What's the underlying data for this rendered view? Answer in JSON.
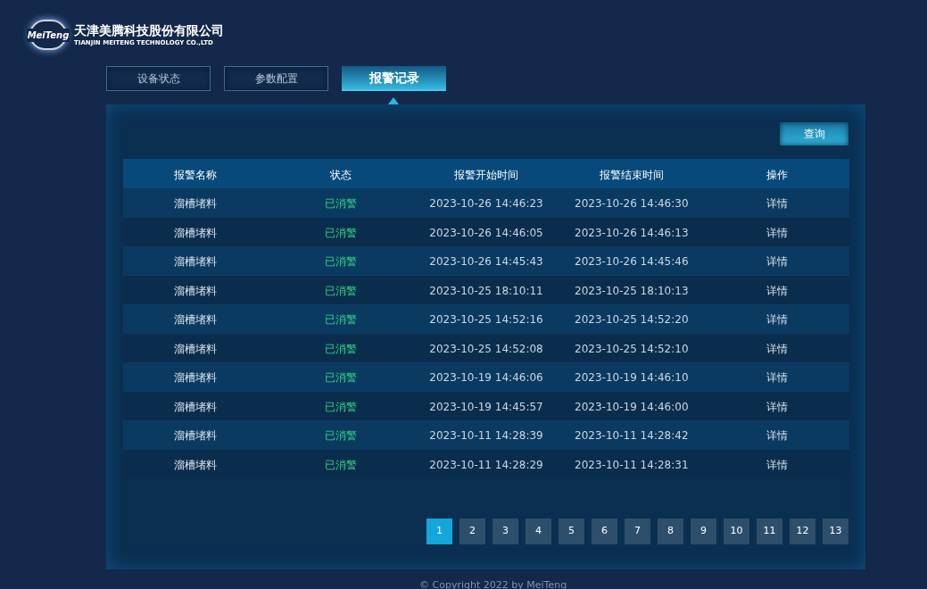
{
  "header": {
    "logo_text": "MeiTeng",
    "company_name": "天津美腾科技股份有限公司",
    "company_name_en": "TIANJIN MEITENG TECHNOLOGY CO.,LTD"
  },
  "tabs": [
    {
      "label": "设备状态",
      "selected": false
    },
    {
      "label": "参数配置",
      "selected": false
    },
    {
      "label": "报警记录",
      "selected": true
    }
  ],
  "query_button": "查询",
  "table": {
    "columns": [
      "报警名称",
      "状态",
      "报警开始时间",
      "报警结束时间",
      "操作"
    ],
    "rows": [
      {
        "name": "溜槽堵料",
        "status": "已消警",
        "start": "2023-10-26 14:46:23",
        "end": "2023-10-26 14:46:30",
        "action": "详情"
      },
      {
        "name": "溜槽堵料",
        "status": "已消警",
        "start": "2023-10-26 14:46:05",
        "end": "2023-10-26 14:46:13",
        "action": "详情"
      },
      {
        "name": "溜槽堵料",
        "status": "已消警",
        "start": "2023-10-26 14:45:43",
        "end": "2023-10-26 14:45:46",
        "action": "详情"
      },
      {
        "name": "溜槽堵料",
        "status": "已消警",
        "start": "2023-10-25 18:10:11",
        "end": "2023-10-25 18:10:13",
        "action": "详情"
      },
      {
        "name": "溜槽堵料",
        "status": "已消警",
        "start": "2023-10-25 14:52:16",
        "end": "2023-10-25 14:52:20",
        "action": "详情"
      },
      {
        "name": "溜槽堵料",
        "status": "已消警",
        "start": "2023-10-25 14:52:08",
        "end": "2023-10-25 14:52:10",
        "action": "详情"
      },
      {
        "name": "溜槽堵料",
        "status": "已消警",
        "start": "2023-10-19 14:46:06",
        "end": "2023-10-19 14:46:10",
        "action": "详情"
      },
      {
        "name": "溜槽堵料",
        "status": "已消警",
        "start": "2023-10-19 14:45:57",
        "end": "2023-10-19 14:46:00",
        "action": "详情"
      },
      {
        "name": "溜槽堵料",
        "status": "已消警",
        "start": "2023-10-11 14:28:39",
        "end": "2023-10-11 14:28:42",
        "action": "详情"
      },
      {
        "name": "溜槽堵料",
        "status": "已消警",
        "start": "2023-10-11 14:28:29",
        "end": "2023-10-11 14:28:31",
        "action": "详情"
      }
    ]
  },
  "pagination": [
    {
      "label": "1",
      "selected": true
    },
    {
      "label": "2",
      "selected": false
    },
    {
      "label": "3",
      "selected": false
    },
    {
      "label": "4",
      "selected": false
    },
    {
      "label": "5",
      "selected": false
    },
    {
      "label": "6",
      "selected": false
    },
    {
      "label": "7",
      "selected": false
    },
    {
      "label": "8",
      "selected": false
    },
    {
      "label": "9",
      "selected": false
    },
    {
      "label": "10",
      "selected": false
    },
    {
      "label": "11",
      "selected": false
    },
    {
      "label": "12",
      "selected": false
    },
    {
      "label": "13",
      "selected": false
    }
  ],
  "footer": "© Copyright 2022 by MeiTeng"
}
